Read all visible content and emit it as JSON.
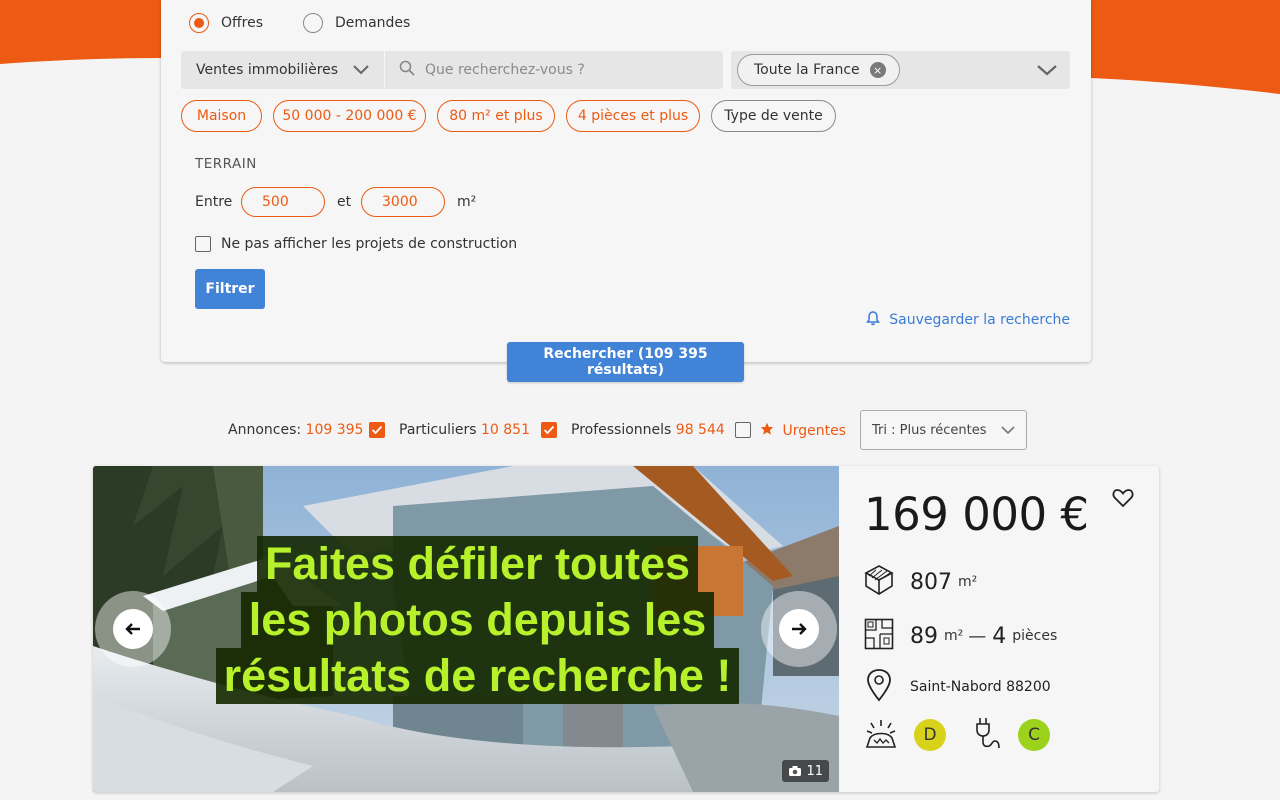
{
  "colors": {
    "brand_orange": "#ec5a13",
    "primary_blue": "#4183d7",
    "dpe_d": "#d8d31a",
    "ges_c": "#9cd21c",
    "overlay_text": "#b6f12b"
  },
  "search": {
    "offer_types": [
      {
        "label": "Offres",
        "selected": true
      },
      {
        "label": "Demandes",
        "selected": false
      }
    ],
    "category": "Ventes immobilières",
    "query_placeholder": "Que recherchez-vous ?",
    "location_tag": "Toute la France",
    "location_remove": "×",
    "filter_chips": [
      {
        "label": "Maison",
        "active": true
      },
      {
        "label": "50 000 - 200 000 €",
        "active": true
      },
      {
        "label": "80 m² et plus",
        "active": true
      },
      {
        "label": "4 pièces et plus",
        "active": true
      },
      {
        "label": "Type de vente",
        "active": false
      }
    ],
    "terrain": {
      "title": "TERRAIN",
      "between": "Entre",
      "and": "et",
      "min": "500",
      "max": "3000",
      "unit": "m²"
    },
    "hide_construction_label": "Ne pas afficher les projets de construction",
    "hide_construction_checked": false,
    "filter_button": "Filtrer",
    "save_search": "Sauvegarder la recherche",
    "search_button": "Rechercher (109 395 résultats)"
  },
  "results_bar": {
    "annonces_label": "Annonces:",
    "annonces_count": "109 395",
    "particuliers_label": "Particuliers",
    "particuliers_count": "10 851",
    "particuliers_checked": true,
    "professionnels_label": "Professionnels",
    "professionnels_count": "98 544",
    "professionnels_checked": true,
    "urgentes_label": "Urgentes",
    "urgentes_checked": false,
    "sort_label": "Tri : Plus récentes"
  },
  "listing": {
    "overlay_lines": [
      "Faites défiler toutes",
      "les photos depuis les",
      "résultats de recherche !"
    ],
    "photo_count": "11",
    "price": "169 000 €",
    "land_value": "807",
    "land_unit": "m²",
    "surface_value": "89",
    "surface_unit": "m²",
    "separator": "—",
    "rooms_value": "4",
    "rooms_unit": "pièces",
    "location": "Saint-Nabord 88200",
    "dpe_rating": "D",
    "ges_rating": "C"
  },
  "icons": [
    "radio-icon",
    "chevron-down-icon",
    "search-icon",
    "close-icon",
    "bell-icon",
    "check-icon",
    "star-icon",
    "arrow-left-icon",
    "arrow-right-icon",
    "camera-icon",
    "heart-icon",
    "land-icon",
    "floorplan-icon",
    "location-pin-icon",
    "energy-icon",
    "plug-icon"
  ]
}
